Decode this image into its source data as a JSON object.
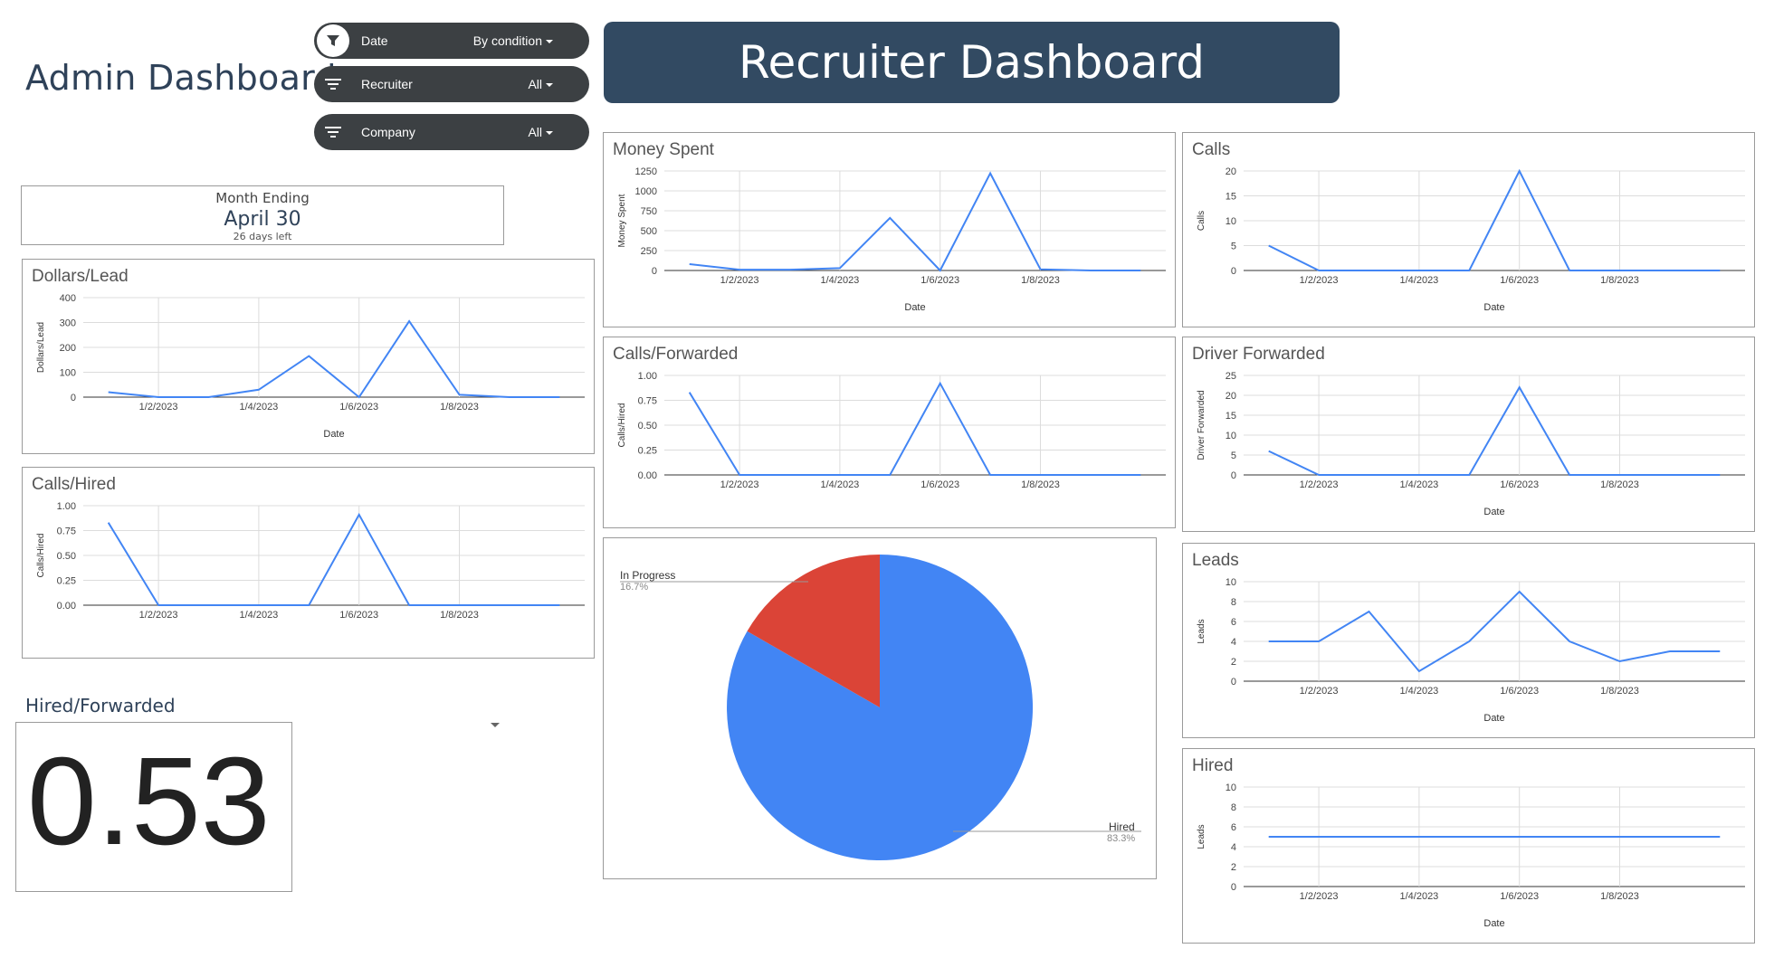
{
  "admin_title": "Admin Dashboard",
  "banner_title": "Recruiter Dashboard",
  "filters": [
    {
      "label": "Date",
      "value": "By condition"
    },
    {
      "label": "Recruiter",
      "value": "All"
    },
    {
      "label": "Company",
      "value": "All"
    }
  ],
  "month_box": {
    "label": "Month Ending",
    "value": "April 30",
    "sub": "26 days left"
  },
  "hired_forwarded": {
    "title": "Hired/Forwarded",
    "value": "0.53"
  },
  "colors": {
    "line": "#4285f4",
    "pie_hired": "#4285f4",
    "pie_in_progress": "#db4437",
    "banner": "#324a62"
  },
  "x_tick_labels": [
    "1/2/2023",
    "1/4/2023",
    "1/6/2023",
    "1/8/2023"
  ],
  "chart_data": [
    {
      "id": "dollars_lead",
      "type": "line",
      "title": "Dollars/Lead",
      "xlabel": "Date",
      "ylabel": "Dollars/Lead",
      "ylim": [
        0,
        400
      ],
      "yticks": [
        "0",
        "100",
        "200",
        "300",
        "400"
      ],
      "x": [
        1,
        2,
        3,
        4,
        5,
        6,
        7,
        8,
        9,
        10
      ],
      "values": [
        20,
        0,
        0,
        30,
        165,
        0,
        305,
        10,
        0,
        0
      ]
    },
    {
      "id": "calls_hired",
      "type": "line",
      "title": "Calls/Hired",
      "xlabel": "",
      "ylabel": "Calls/Hired",
      "ylim": [
        0,
        1
      ],
      "yticks": [
        "0.00",
        "0.25",
        "0.50",
        "0.75",
        "1.00"
      ],
      "x": [
        1,
        2,
        3,
        4,
        5,
        6,
        7,
        8,
        9,
        10
      ],
      "values": [
        0.83,
        0,
        0,
        0,
        0,
        0.91,
        0,
        0,
        0,
        0
      ]
    },
    {
      "id": "money_spent",
      "type": "line",
      "title": "Money Spent",
      "xlabel": "Date",
      "ylabel": "Money Spent",
      "ylim": [
        0,
        1250
      ],
      "yticks": [
        "0",
        "250",
        "500",
        "750",
        "1000",
        "1250"
      ],
      "x": [
        1,
        2,
        3,
        4,
        5,
        6,
        7,
        8,
        9,
        10
      ],
      "values": [
        80,
        10,
        10,
        30,
        660,
        0,
        1220,
        15,
        0,
        0
      ]
    },
    {
      "id": "calls_forwarded",
      "type": "line",
      "title": "Calls/Forwarded",
      "xlabel": "",
      "ylabel": "Calls/Hired",
      "ylim": [
        0,
        1
      ],
      "yticks": [
        "0.00",
        "0.25",
        "0.50",
        "0.75",
        "1.00"
      ],
      "x": [
        1,
        2,
        3,
        4,
        5,
        6,
        7,
        8,
        9,
        10
      ],
      "values": [
        0.83,
        0,
        0,
        0,
        0,
        0.92,
        0,
        0,
        0,
        0
      ]
    },
    {
      "id": "calls",
      "type": "line",
      "title": "Calls",
      "xlabel": "Date",
      "ylabel": "Calls",
      "ylim": [
        0,
        20
      ],
      "yticks": [
        "0",
        "5",
        "10",
        "15",
        "20"
      ],
      "x": [
        1,
        2,
        3,
        4,
        5,
        6,
        7,
        8,
        9,
        10
      ],
      "values": [
        5,
        0,
        0,
        0,
        0,
        20,
        0,
        0,
        0,
        0
      ]
    },
    {
      "id": "driver_forwarded",
      "type": "line",
      "title": "Driver Forwarded",
      "xlabel": "Date",
      "ylabel": "Driver Forwarded",
      "ylim": [
        0,
        25
      ],
      "yticks": [
        "0",
        "5",
        "10",
        "15",
        "20",
        "25"
      ],
      "x": [
        1,
        2,
        3,
        4,
        5,
        6,
        7,
        8,
        9,
        10
      ],
      "values": [
        6,
        0,
        0,
        0,
        0,
        22,
        0,
        0,
        0,
        0
      ]
    },
    {
      "id": "leads",
      "type": "line",
      "title": "Leads",
      "xlabel": "Date",
      "ylabel": "Leads",
      "ylim": [
        0,
        10
      ],
      "yticks": [
        "0",
        "2",
        "4",
        "6",
        "8",
        "10"
      ],
      "x": [
        1,
        2,
        3,
        4,
        5,
        6,
        7,
        8,
        9,
        10
      ],
      "values": [
        4,
        4,
        7,
        1,
        4,
        9,
        4,
        2,
        3,
        3
      ]
    },
    {
      "id": "hired",
      "type": "line",
      "title": "Hired",
      "xlabel": "Date",
      "ylabel": "Leads",
      "ylim": [
        0,
        10
      ],
      "yticks": [
        "0",
        "2",
        "4",
        "6",
        "8",
        "10"
      ],
      "x": [
        1,
        2,
        3,
        4,
        5,
        6,
        7,
        8,
        9,
        10
      ],
      "values": [
        5,
        5,
        5,
        5,
        5,
        5,
        5,
        5,
        5,
        5
      ]
    },
    {
      "id": "status_pie",
      "type": "pie",
      "labels": [
        "Hired",
        "In Progress"
      ],
      "values": [
        83.3,
        16.7
      ],
      "percent_labels": [
        "83.3%",
        "16.7%"
      ]
    }
  ]
}
